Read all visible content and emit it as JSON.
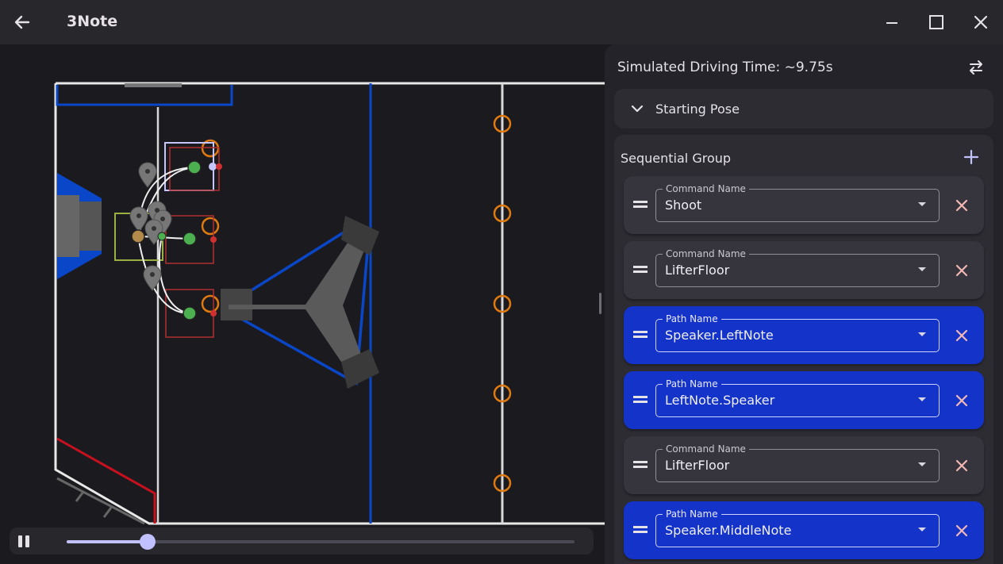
{
  "window": {
    "title": "3Note"
  },
  "sidebar": {
    "simulated_time_label": "Simulated Driving Time: ~9.75s",
    "starting_pose": {
      "label": "Starting Pose"
    },
    "group": {
      "title": "Sequential Group",
      "commands": [
        {
          "kind": "command",
          "field_label": "Command Name",
          "value": "Shoot"
        },
        {
          "kind": "command",
          "field_label": "Command Name",
          "value": "LifterFloor"
        },
        {
          "kind": "path",
          "field_label": "Path Name",
          "value": "Speaker.LeftNote"
        },
        {
          "kind": "path",
          "field_label": "Path Name",
          "value": "LeftNote.Speaker"
        },
        {
          "kind": "command",
          "field_label": "Command Name",
          "value": "LifterFloor"
        },
        {
          "kind": "path",
          "field_label": "Path Name",
          "value": "Speaker.MiddleNote"
        }
      ]
    }
  },
  "player": {
    "state": "playing",
    "progress": 0.16
  },
  "icons": {
    "back": "arrow-left-icon",
    "minimize": "minimize-icon",
    "maximize": "maximize-icon",
    "close": "close-icon",
    "swap": "swap-horizontal-icon",
    "expand": "chevron-down-icon",
    "add": "plus-icon",
    "drag": "drag-handle-icon",
    "remove": "close-icon",
    "pause": "pause-icon"
  },
  "colors": {
    "path_row": "#1434c9",
    "command_row": "#36343c",
    "remove_icon": "#f2b8b5",
    "add_icon": "#c2c1ff",
    "slider": "#c2c1ff",
    "alliance_blue": "#0a47c8",
    "alliance_red": "#c8101e",
    "note_ring": "#e07a10",
    "robot_pose_marker": "#4caf50"
  }
}
